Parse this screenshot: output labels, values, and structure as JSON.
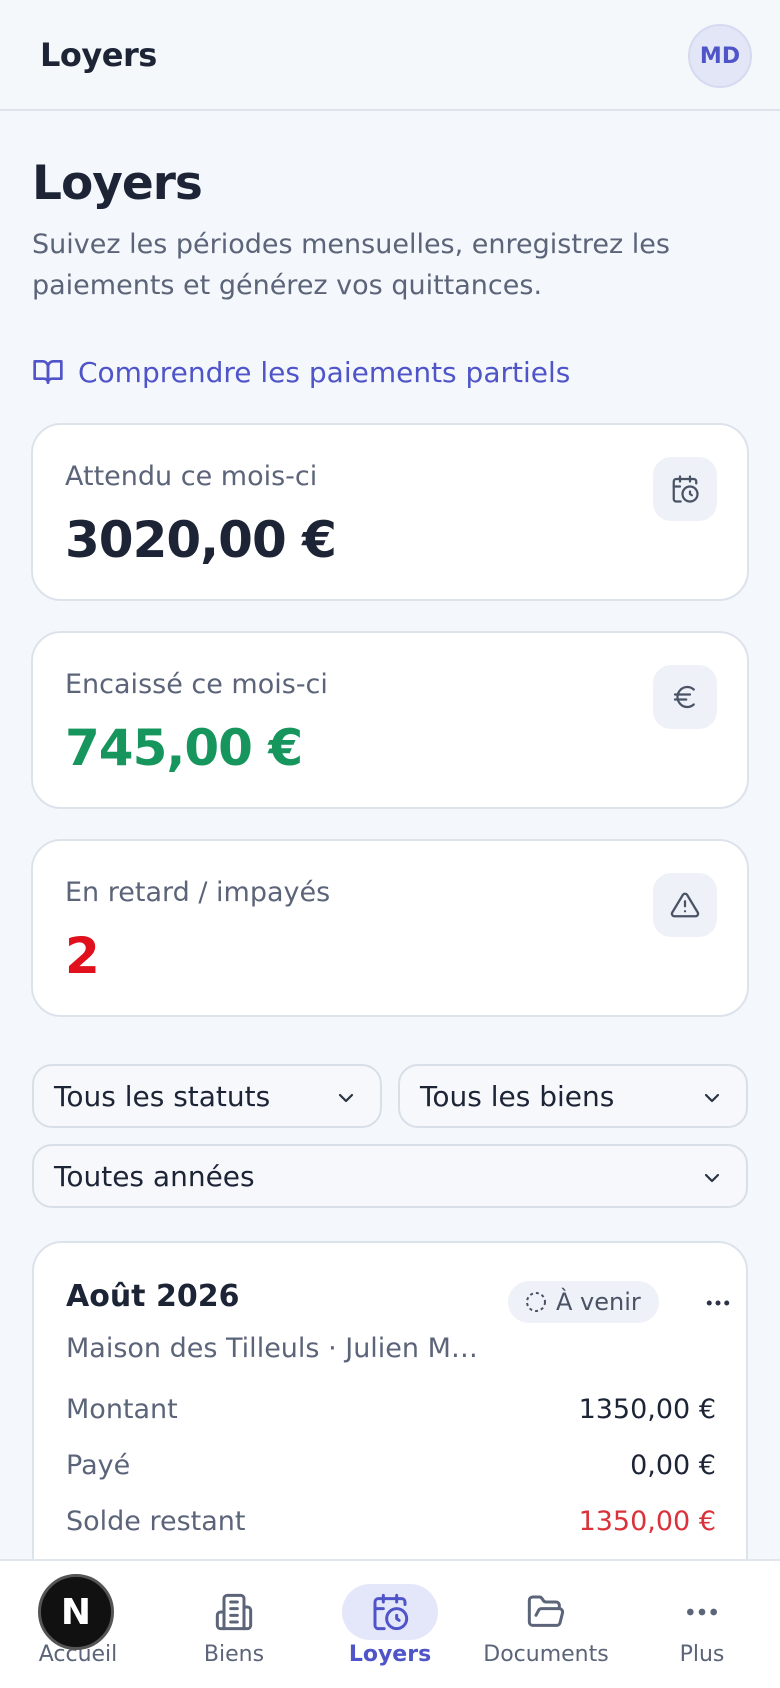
{
  "topbar": {
    "title": "Loyers",
    "avatar_initials": "MD"
  },
  "page": {
    "title": "Loyers",
    "subtitle": "Suivez les périodes mensuelles, enregistrez les paiements et générez vos quittances.",
    "help_link": "Comprendre les paiements partiels"
  },
  "stats": {
    "expected": {
      "label": "Attendu ce mois-ci",
      "value": "3020,00 €",
      "icon": "calendar-clock-icon"
    },
    "collected": {
      "label": "Encaissé ce mois-ci",
      "value": "745,00 €",
      "icon": "euro-icon"
    },
    "late": {
      "label": "En retard / impayés",
      "value": "2",
      "icon": "warning-icon"
    }
  },
  "filters": {
    "status": "Tous les statuts",
    "property": "Tous les biens",
    "year": "Toutes années"
  },
  "rent_card": {
    "month": "Août 2026",
    "badge": "À venir",
    "subtitle": "Maison des Tilleuls · Julien Mor…",
    "rows": [
      {
        "label": "Montant",
        "value": "1350,00 €"
      },
      {
        "label": "Payé",
        "value": "0,00 €"
      },
      {
        "label": "Solde restant",
        "value": "1350,00 €"
      }
    ]
  },
  "nav": {
    "items": [
      {
        "label": "Accueil",
        "icon": "home-icon"
      },
      {
        "label": "Biens",
        "icon": "building-icon"
      },
      {
        "label": "Loyers",
        "icon": "calendar-clock-icon",
        "active": true
      },
      {
        "label": "Documents",
        "icon": "folder-icon"
      },
      {
        "label": "Plus",
        "icon": "more-icon"
      }
    ]
  },
  "floating_badge": "N",
  "colors": {
    "accent": "#4f55c8",
    "positive": "#16955c",
    "negative": "#e0101c",
    "balance_due": "#d9323b"
  }
}
